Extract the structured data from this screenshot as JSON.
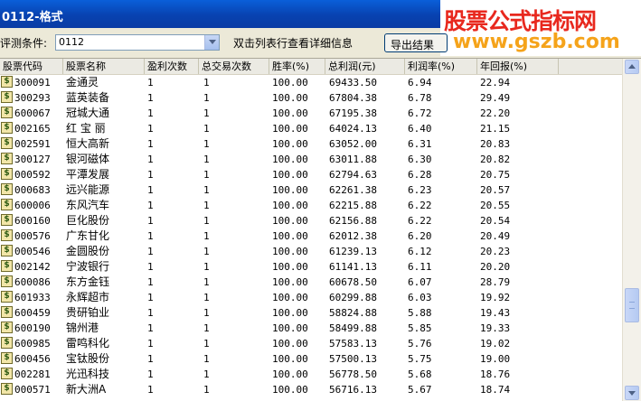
{
  "window": {
    "title": "0112-格式"
  },
  "watermark": {
    "cn": "股票公式指标网",
    "url": "www.gszb.com"
  },
  "toolbar": {
    "condition_label": "评测条件:",
    "condition_value": "0112",
    "hint": "双击列表行查看详细信息",
    "export_label": "导出结果"
  },
  "table": {
    "columns": [
      "股票代码",
      "股票名称",
      "盈利次数",
      "总交易次数",
      "胜率(%)",
      "总利润(元)",
      "利润率(%)",
      "年回报(%)"
    ],
    "rows": [
      [
        "300091",
        "金通灵",
        "1",
        "1",
        "100.00",
        "69433.50",
        "6.94",
        "22.94"
      ],
      [
        "300293",
        "蓝英装备",
        "1",
        "1",
        "100.00",
        "67804.38",
        "6.78",
        "29.49"
      ],
      [
        "600067",
        "冠城大通",
        "1",
        "1",
        "100.00",
        "67195.38",
        "6.72",
        "22.20"
      ],
      [
        "002165",
        "红 宝 丽",
        "1",
        "1",
        "100.00",
        "64024.13",
        "6.40",
        "21.15"
      ],
      [
        "002591",
        "恒大高新",
        "1",
        "1",
        "100.00",
        "63052.00",
        "6.31",
        "20.83"
      ],
      [
        "300127",
        "银河磁体",
        "1",
        "1",
        "100.00",
        "63011.88",
        "6.30",
        "20.82"
      ],
      [
        "000592",
        "平潭发展",
        "1",
        "1",
        "100.00",
        "62794.63",
        "6.28",
        "20.75"
      ],
      [
        "000683",
        "远兴能源",
        "1",
        "1",
        "100.00",
        "62261.38",
        "6.23",
        "20.57"
      ],
      [
        "600006",
        "东风汽车",
        "1",
        "1",
        "100.00",
        "62215.88",
        "6.22",
        "20.55"
      ],
      [
        "600160",
        "巨化股份",
        "1",
        "1",
        "100.00",
        "62156.88",
        "6.22",
        "20.54"
      ],
      [
        "000576",
        "广东甘化",
        "1",
        "1",
        "100.00",
        "62012.38",
        "6.20",
        "20.49"
      ],
      [
        "000546",
        "金圆股份",
        "1",
        "1",
        "100.00",
        "61239.13",
        "6.12",
        "20.23"
      ],
      [
        "002142",
        "宁波银行",
        "1",
        "1",
        "100.00",
        "61141.13",
        "6.11",
        "20.20"
      ],
      [
        "600086",
        "东方金钰",
        "1",
        "1",
        "100.00",
        "60678.50",
        "6.07",
        "28.79"
      ],
      [
        "601933",
        "永辉超市",
        "1",
        "1",
        "100.00",
        "60299.88",
        "6.03",
        "19.92"
      ],
      [
        "600459",
        "贵研铂业",
        "1",
        "1",
        "100.00",
        "58824.88",
        "5.88",
        "19.43"
      ],
      [
        "600190",
        "锦州港",
        "1",
        "1",
        "100.00",
        "58499.88",
        "5.85",
        "19.33"
      ],
      [
        "600985",
        "雷鸣科化",
        "1",
        "1",
        "100.00",
        "57583.13",
        "5.76",
        "19.02"
      ],
      [
        "600456",
        "宝钛股份",
        "1",
        "1",
        "100.00",
        "57500.13",
        "5.75",
        "19.00"
      ],
      [
        "002281",
        "光迅科技",
        "1",
        "1",
        "100.00",
        "56778.50",
        "5.68",
        "18.76"
      ],
      [
        "000571",
        "新大洲A",
        "1",
        "1",
        "100.00",
        "56716.13",
        "5.67",
        "18.74"
      ]
    ]
  },
  "row_icon": {
    "icon": "stock-dollar-icon",
    "glyph": "$"
  }
}
